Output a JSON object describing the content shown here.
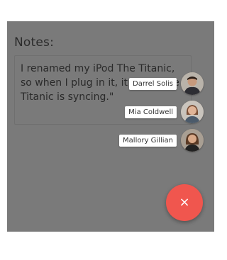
{
  "notes": {
    "label": "Notes:",
    "text": "I renamed my iPod The Titanic, so when I plug in it, it says \"The Titanic is syncing.\""
  },
  "contacts": [
    {
      "name": "Darrel Solis",
      "avatar_icon": "person-avatar"
    },
    {
      "name": "Mia Coldwell",
      "avatar_icon": "person-avatar"
    },
    {
      "name": "Mallory Gillian",
      "avatar_icon": "person-avatar"
    }
  ],
  "fab": {
    "icon": "close-icon",
    "glyph": "×",
    "color": "#f0564e"
  },
  "colors": {
    "overlay": "#7a7a7a"
  }
}
